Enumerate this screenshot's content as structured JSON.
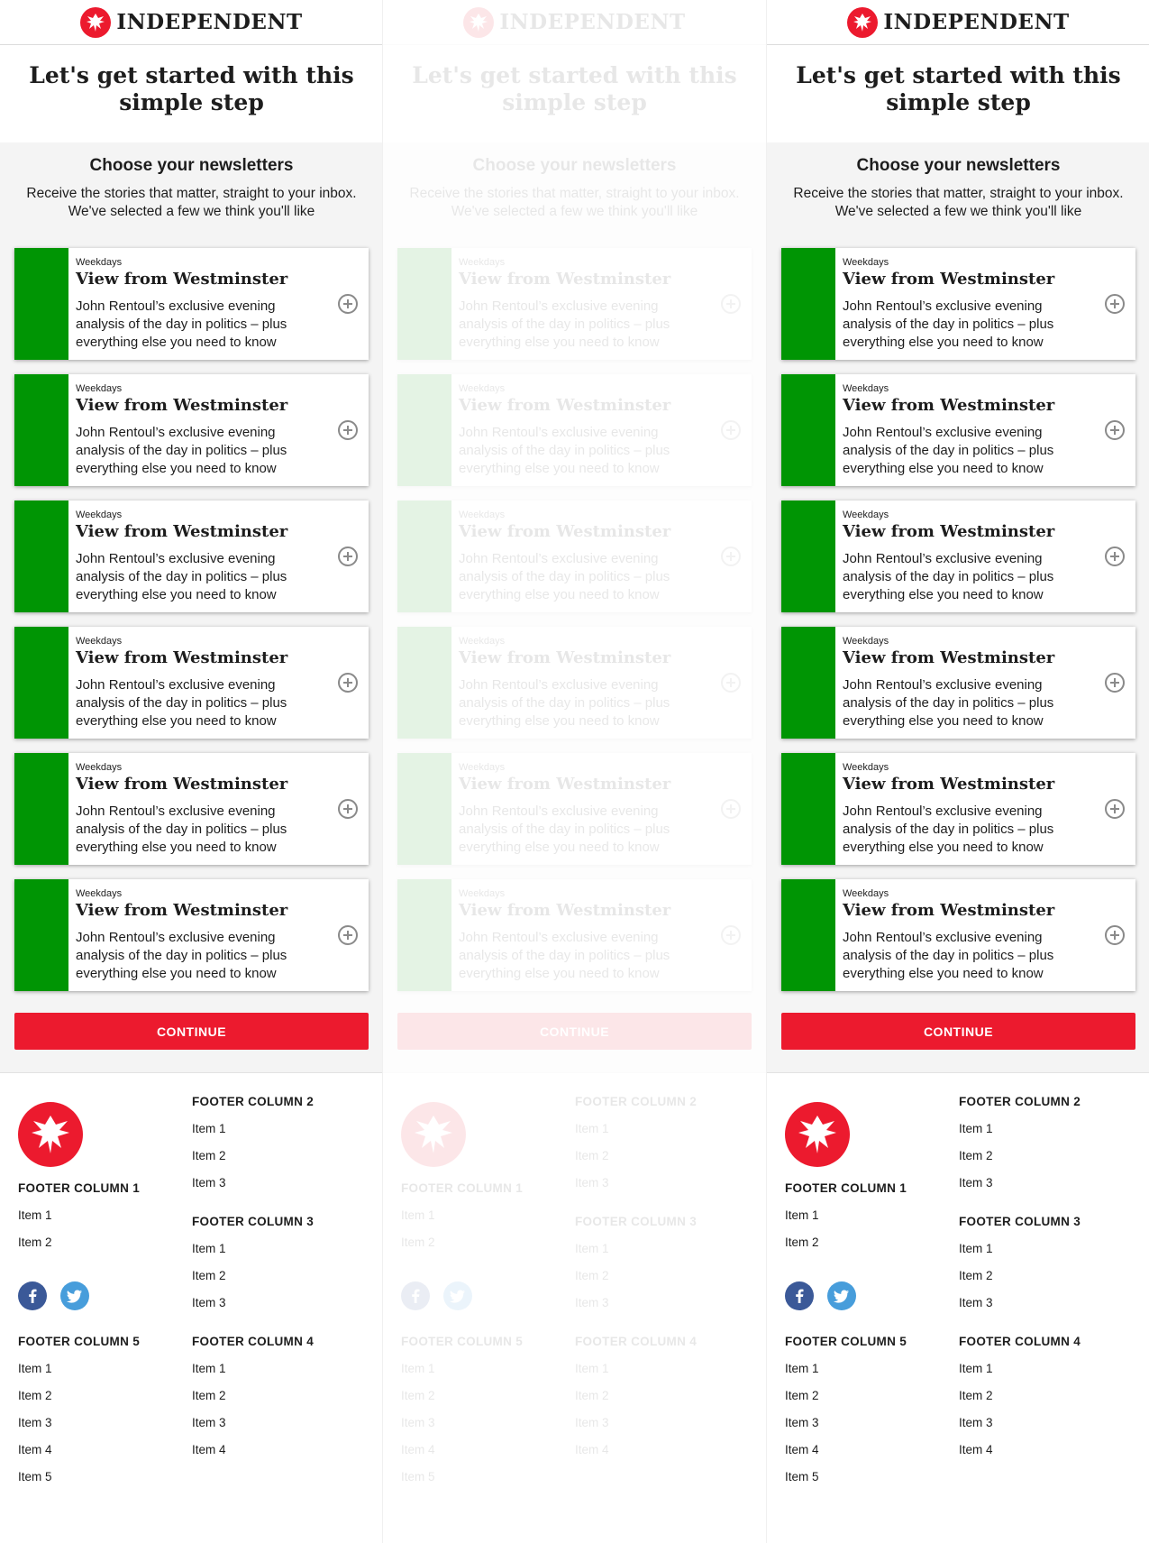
{
  "brand": {
    "name": "INDEPENDENT",
    "accent_color": "#ec1a2e",
    "stripe_color": "#009504"
  },
  "headline": "Let's get started with this simple step",
  "section": {
    "title": "Choose your newsletters",
    "subtitle": "Receive the stories that matter, straight to your inbox. We've selected a few we think you'll like"
  },
  "newsletters": [
    {
      "frequency": "Weekdays",
      "title": "View from Westminster",
      "description": "John Rentoul’s exclusive evening analysis of the day in politics – plus everything else you need to know",
      "icon": "plus-circle-icon"
    },
    {
      "frequency": "Weekdays",
      "title": "View from Westminster",
      "description": "John Rentoul’s exclusive evening analysis of the day in politics – plus everything else you need to know",
      "icon": "plus-circle-icon"
    },
    {
      "frequency": "Weekdays",
      "title": "View from Westminster",
      "description": "John Rentoul’s exclusive evening analysis of the day in politics – plus everything else you need to know",
      "icon": "plus-circle-icon"
    },
    {
      "frequency": "Weekdays",
      "title": "View from Westminster",
      "description": "John Rentoul’s exclusive evening analysis of the day in politics – plus everything else you need to know",
      "icon": "plus-circle-icon"
    },
    {
      "frequency": "Weekdays",
      "title": "View from Westminster",
      "description": "John Rentoul’s exclusive evening analysis of the day in politics – plus everything else you need to know",
      "icon": "plus-circle-icon"
    },
    {
      "frequency": "Weekdays",
      "title": "View from Westminster",
      "description": "John Rentoul’s exclusive evening analysis of the day in politics – plus everything else you need to know",
      "icon": "plus-circle-icon"
    }
  ],
  "continue_label": "CONTINUE",
  "footer": {
    "col1": {
      "title": "FOOTER COLUMN 1",
      "items": [
        "Item 1",
        "Item 2"
      ]
    },
    "col2": {
      "title": "FOOTER COLUMN 2",
      "items": [
        "Item 1",
        "Item 2",
        "Item 3"
      ]
    },
    "col3": {
      "title": "FOOTER COLUMN 3",
      "items": [
        "Item 1",
        "Item 2",
        "Item 3"
      ]
    },
    "col4": {
      "title": "FOOTER COLUMN 4",
      "items": [
        "Item 1",
        "Item 2",
        "Item 3",
        "Item 4"
      ]
    },
    "col5": {
      "title": "FOOTER COLUMN 5",
      "items": [
        "Item 1",
        "Item 2",
        "Item 3",
        "Item 4",
        "Item 5"
      ]
    },
    "social": [
      {
        "icon": "facebook-icon",
        "color": "#3b5998"
      },
      {
        "icon": "twitter-icon",
        "color": "#479ddb"
      }
    ]
  }
}
